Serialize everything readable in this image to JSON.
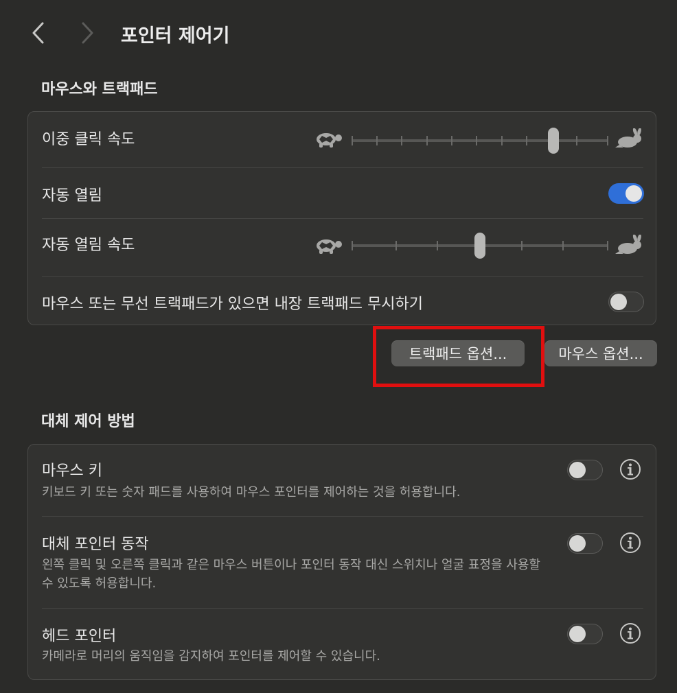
{
  "header": {
    "title": "포인터 제어기"
  },
  "sections": {
    "mouse_trackpad": {
      "title": "마우스와 트랙패드"
    },
    "alternate": {
      "title": "대체 제어 방법"
    }
  },
  "mouse_trackpad": {
    "double_click_speed": {
      "label": "이중 클릭 속도",
      "ticks": 11,
      "value_index": 8
    },
    "spring_loading": {
      "label": "자동 열림",
      "enabled": true
    },
    "spring_loading_speed": {
      "label": "자동 열림 속도",
      "ticks": 7,
      "value_index": 3
    },
    "ignore_builtin": {
      "label": "마우스 또는 무선 트랙패드가 있으면 내장 트랙패드 무시하기",
      "enabled": false
    }
  },
  "buttons": {
    "trackpad_options": "트랙패드 옵션...",
    "mouse_options": "마우스 옵션..."
  },
  "alternate": {
    "mouse_keys": {
      "title": "마우스 키",
      "desc": "키보드 키 또는 숫자 패드를 사용하여 마우스 포인터를 제어하는 것을 허용합니다.",
      "enabled": false
    },
    "alt_pointer_actions": {
      "title": "대체 포인터 동작",
      "desc": "왼쪽 클릭 및 오른쪽 클릭과 같은 마우스 버튼이나 포인터 동작 대신 스위치나 얼굴 표정을 사용할 수 있도록 허용합니다.",
      "enabled": false
    },
    "head_pointer": {
      "title": "헤드 포인터",
      "desc": "카메라로 머리의 움직임을 감지하여 포인터를 제어할 수 있습니다.",
      "enabled": false
    }
  },
  "colors": {
    "accent": "#2f6fd8",
    "highlight": "#e00f0f",
    "background": "#2b2b29"
  },
  "icons": [
    "chevron-left-icon",
    "chevron-right-icon",
    "turtle-icon",
    "rabbit-icon",
    "info-icon"
  ]
}
